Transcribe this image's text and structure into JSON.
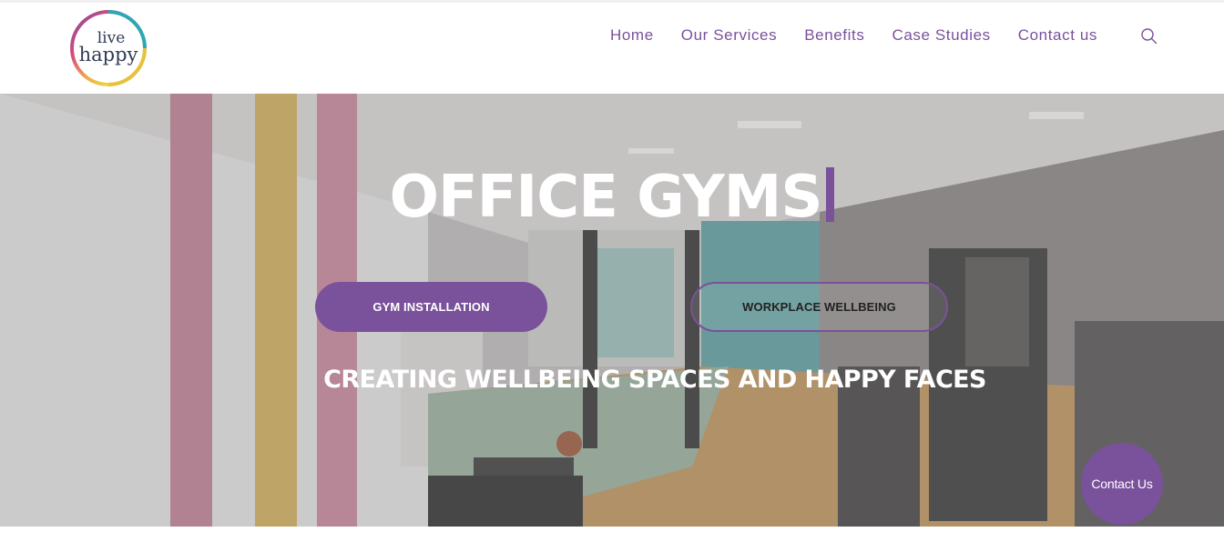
{
  "brand": {
    "logo_line1": "live",
    "logo_line2": "happy"
  },
  "nav": {
    "items": [
      {
        "label": "Home"
      },
      {
        "label": "Our Services"
      },
      {
        "label": "Benefits"
      },
      {
        "label": "Case Studies"
      },
      {
        "label": "Contact us"
      }
    ],
    "search_icon": "search-icon"
  },
  "hero": {
    "title": "OFFICE GYMS",
    "primary_button": "GYM INSTALLATION",
    "secondary_button": "WORKPLACE WELLBEING",
    "tagline": "CREATING WELLBEING SPACES AND HAPPY FACES"
  },
  "floating_button": {
    "label": "Contact Us"
  },
  "colors": {
    "accent": "#7a519b",
    "text_on_hero": "#ffffff",
    "header_bg": "#ffffff"
  }
}
